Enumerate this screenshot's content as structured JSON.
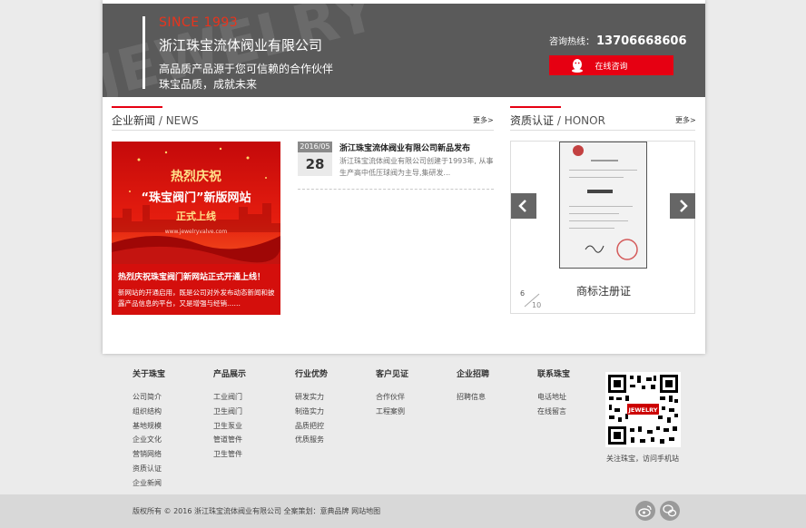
{
  "banner": {
    "since": "SINCE 1993",
    "company_name": "浙江珠宝流体阀业有限公司",
    "slogan_line1": "高品质产品源于您可信赖的合作伙伴",
    "slogan_line2": "珠宝品质，成就未来",
    "watermark_text": "JEWELRY",
    "hotline_label": "咨询热线：",
    "hotline_number": "13706668606",
    "consult_button": "在线咨询"
  },
  "news": {
    "title_cn": "企业新闻",
    "title_sep": " / ",
    "title_en": "NEWS",
    "more": "更多>",
    "image": {
      "headline1": "热烈庆祝",
      "headline2": "“珠宝阀门”新版网站",
      "headline3": "正式上线",
      "site_url": "www.jewelryvalve.com",
      "caption_title": "热烈庆祝珠宝阀门新网站正式开通上线！",
      "caption_desc": "新网站的开通启用，既是公司对外发布动态新闻和披露产品信息的平台，又是增强与经销……"
    },
    "item": {
      "date_ym": "2016/05",
      "date_day": "28",
      "title": "浙江珠宝流体阀业有限公司新品发布",
      "summary": "浙江珠宝流体阀业有限公司创建于1993年, 从事生产高中低压球阀为主导,集研发..."
    }
  },
  "honor": {
    "title_cn": "资质认证",
    "title_sep": " / ",
    "title_en": "HONOR",
    "more": "更多>",
    "caption": "商标注册证",
    "page_current": "6",
    "page_total": "10"
  },
  "footer": {
    "columns": [
      {
        "heading": "关于珠宝",
        "links": [
          "公司简介",
          "组织结构",
          "基地规模",
          "企业文化",
          "营销网络",
          "资质认证",
          "企业新闻"
        ]
      },
      {
        "heading": "产品展示",
        "links": [
          "工业阀门",
          "卫生阀门",
          "卫生泵业",
          "管道管件",
          "卫生管件"
        ]
      },
      {
        "heading": "行业优势",
        "links": [
          "研发实力",
          "制造实力",
          "品质把控",
          "优质服务"
        ]
      },
      {
        "heading": "客户见证",
        "links": [
          "合作伙伴",
          "工程案例"
        ]
      },
      {
        "heading": "企业招聘",
        "links": [
          "招聘信息"
        ]
      },
      {
        "heading": "联系珠宝",
        "links": [
          "电话地址",
          "在线留言"
        ]
      }
    ],
    "qr_caption": "关注珠宝，访问手机站",
    "qr_center_label": "JEWELRY",
    "copyright": "版权所有 © 2016 浙江珠宝流体阀业有限公司 全案策划：意典品牌 网站地图"
  },
  "colors": {
    "accent_red": "#e60012",
    "banner_gray": "#5a5a5a",
    "footer_gray": "#ebebeb"
  },
  "icons": [
    "qq-penguin-icon",
    "chevron-left-icon",
    "chevron-right-icon",
    "weibo-icon",
    "wechat-icon"
  ]
}
